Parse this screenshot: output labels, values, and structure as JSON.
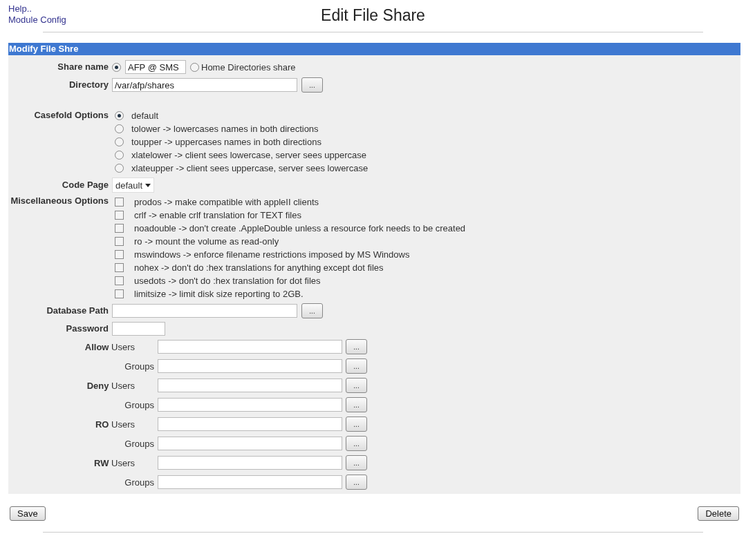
{
  "links": [
    "Help..",
    "Module Config"
  ],
  "title": "Edit File Share",
  "section": {
    "title": "Modify File Shre"
  },
  "share_name": {
    "label": "Share name",
    "options": [
      {
        "kind": "field",
        "value": "AFP @ SMS",
        "selected": true
      },
      {
        "kind": "text",
        "label": "Home Directories share",
        "selected": false
      }
    ]
  },
  "directory": {
    "label": "Directory",
    "value": "/var/afp/shares",
    "button": "..."
  },
  "casefold": {
    "label": "Casefold Options",
    "options": [
      {
        "label": "default",
        "selected": true
      },
      {
        "label": "tolower -> lowercases names in both directions",
        "selected": false
      },
      {
        "label": "toupper -> uppercases names in both directions",
        "selected": false
      },
      {
        "label": "xlatelower -> client sees lowercase, server sees uppercase",
        "selected": false
      },
      {
        "label": "xlateupper -> client sees uppercase, server sees lowercase",
        "selected": false
      }
    ]
  },
  "code_page": {
    "label": "Code Page",
    "value": "default"
  },
  "misc": {
    "label": "Miscellaneous Options",
    "options": [
      {
        "label": "prodos -> make compatible with appleII clients",
        "checked": false
      },
      {
        "label": "crlf -> enable crlf translation for TEXT files",
        "checked": false
      },
      {
        "label": "noadouble -> don't create .AppleDouble unless a resource fork needs to be created",
        "checked": false
      },
      {
        "label": "ro -> mount the volume as read-only",
        "checked": false
      },
      {
        "label": "mswindows -> enforce filename restrictions imposed by MS Windows",
        "checked": false
      },
      {
        "label": "nohex -> don't do :hex translations for anything except dot files",
        "checked": false
      },
      {
        "label": "usedots -> don't do :hex translation for dot files",
        "checked": false
      },
      {
        "label": "limitsize -> limit disk size reporting to 2GB.",
        "checked": false
      }
    ]
  },
  "database_path": {
    "label": "Database Path",
    "button": "..."
  },
  "password": {
    "label": "Password"
  },
  "access": [
    {
      "users_label": "**Allow** Users",
      "groups_label": "Groups",
      "button": "..."
    },
    {
      "users_label": "**Deny** Users",
      "groups_label": "Groups",
      "button": "..."
    },
    {
      "users_label": "**RO** Users",
      "groups_label": "Groups",
      "button": "..."
    },
    {
      "users_label": "**RW** Users",
      "groups_label": "Groups",
      "button": "..."
    }
  ],
  "buttons": {
    "save": "Save",
    "delete": "Delete"
  }
}
